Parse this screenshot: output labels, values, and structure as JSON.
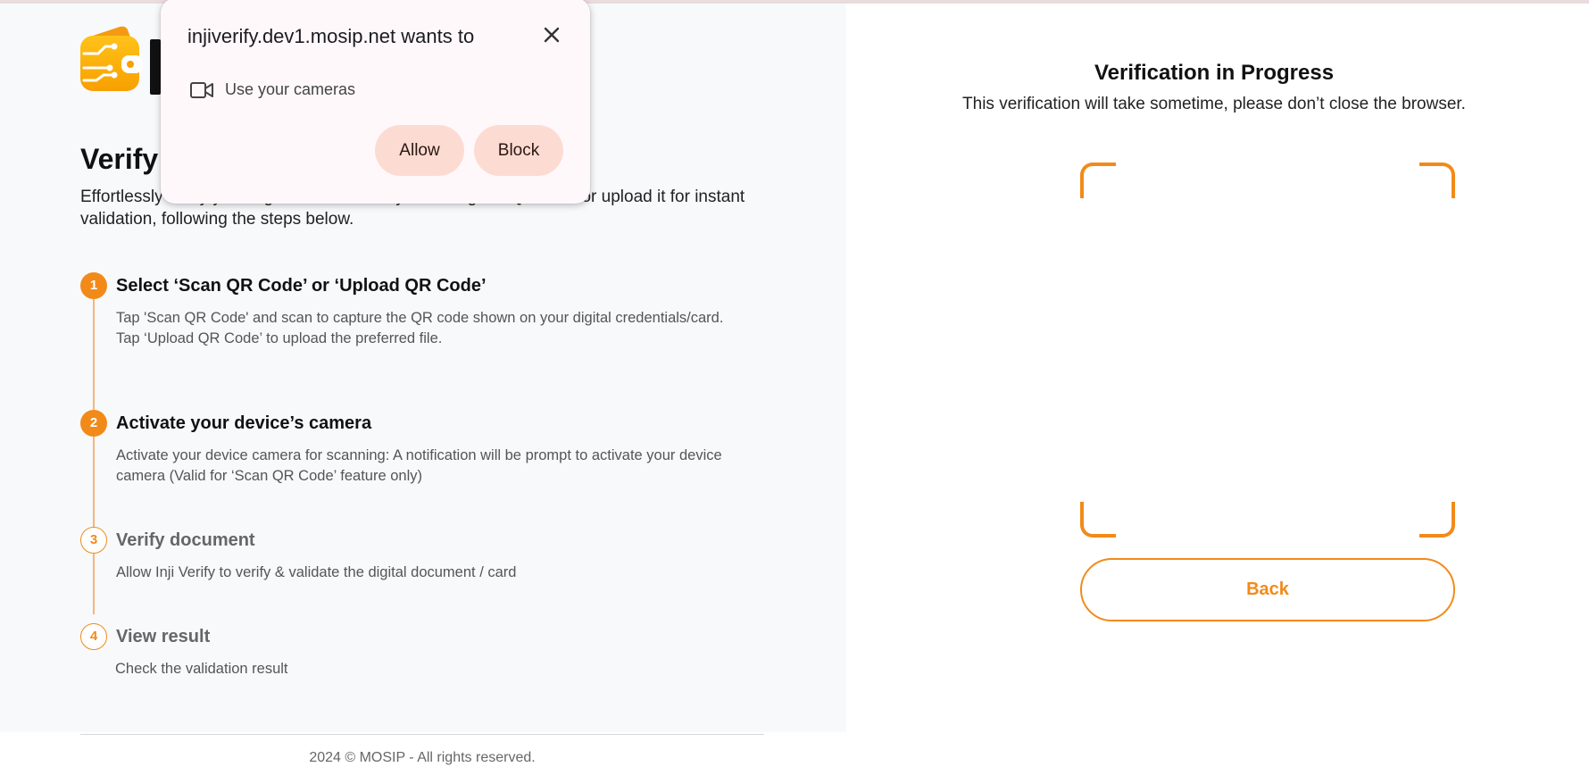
{
  "left": {
    "title": "Verify",
    "description": "Effortlessly verify your digital credentials by scanning the QR code or upload it for instant validation, following the steps below.",
    "steps": [
      {
        "num": "1",
        "title": "Select ‘Scan QR Code’ or ‘Upload QR Code’",
        "desc": [
          "Tap 'Scan QR Code' and scan to capture the QR code shown on your digital credentials/card.",
          "Tap ‘Upload QR Code’ to upload the preferred file."
        ]
      },
      {
        "num": "2",
        "title": "Activate your device’s camera",
        "desc": [
          "Activate your device camera for scanning: A notification will be prompt to activate your device camera (Valid for ‘Scan QR Code’ feature only)"
        ]
      },
      {
        "num": "3",
        "title": "Verify document",
        "desc": [
          "Allow Inji Verify to verify & validate the digital document / card"
        ]
      },
      {
        "num": "4",
        "title": "View result",
        "desc": [
          "Check the validation result"
        ]
      }
    ],
    "footer": "2024 © MOSIP - All rights reserved."
  },
  "right": {
    "title": "Verification in Progress",
    "subtitle": "This verification will take sometime, please don’t close the browser.",
    "back_label": "Back"
  },
  "popup": {
    "title": "injiverify.dev1.mosip.net wants to",
    "permission_icon": "video-camera-icon",
    "permission_text": "Use your cameras",
    "allow_label": "Allow",
    "block_label": "Block",
    "close_icon": "close-icon"
  },
  "colors": {
    "accent": "#f28a1a",
    "popup_button": "#fcdcd2",
    "left_background": "#f8f9fb"
  }
}
